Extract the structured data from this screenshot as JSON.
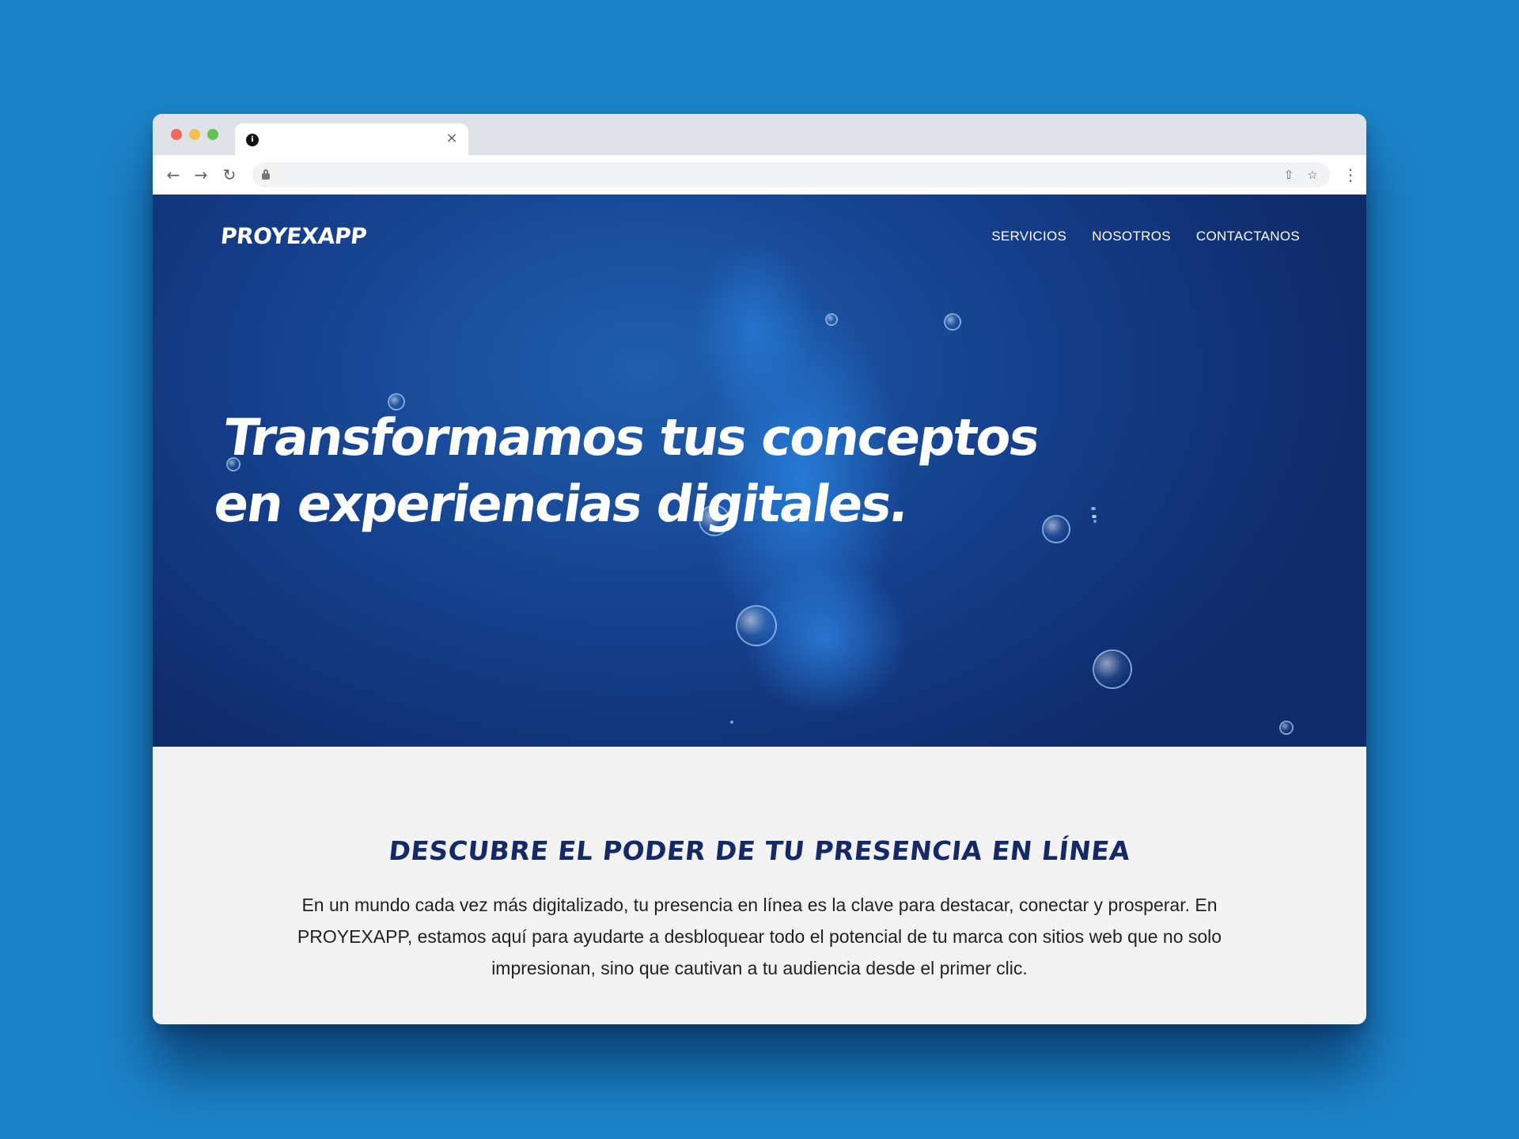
{
  "browser": {
    "tab_title": "",
    "favicon_glyph": "i",
    "close_glyph": "×",
    "url": ""
  },
  "site": {
    "logo": "PROYEXAPP",
    "nav": [
      "SERVICIOS",
      "NOSOTROS",
      "CONTACTANOS"
    ],
    "hero_title": "Transformamos tus conceptos en experiencias digitales.",
    "section_title": "DESCUBRE EL PODER DE TU PRESENCIA EN LÍNEA",
    "section_body": "En un mundo cada vez más digitalizado, tu presencia en línea es la clave para destacar, conectar y prosperar. En PROYEXAPP, estamos aquí para ayudarte a desbloquear todo el potencial de tu marca con sitios web que no solo impresionan, sino que cautivan a tu audiencia desde el primer clic."
  },
  "icons": {
    "back": "arrow-left-icon",
    "forward": "arrow-right-icon",
    "reload": "reload-icon",
    "lock": "lock-icon",
    "share": "share-icon",
    "bookmark": "star-icon",
    "menu": "kebab-menu-icon"
  },
  "colors": {
    "page_background": "#1b83c8",
    "hero_dark": "#0f2b6a",
    "hero_light": "#2882e1",
    "section_title": "#142a66",
    "content_background": "#f3f3f3"
  }
}
